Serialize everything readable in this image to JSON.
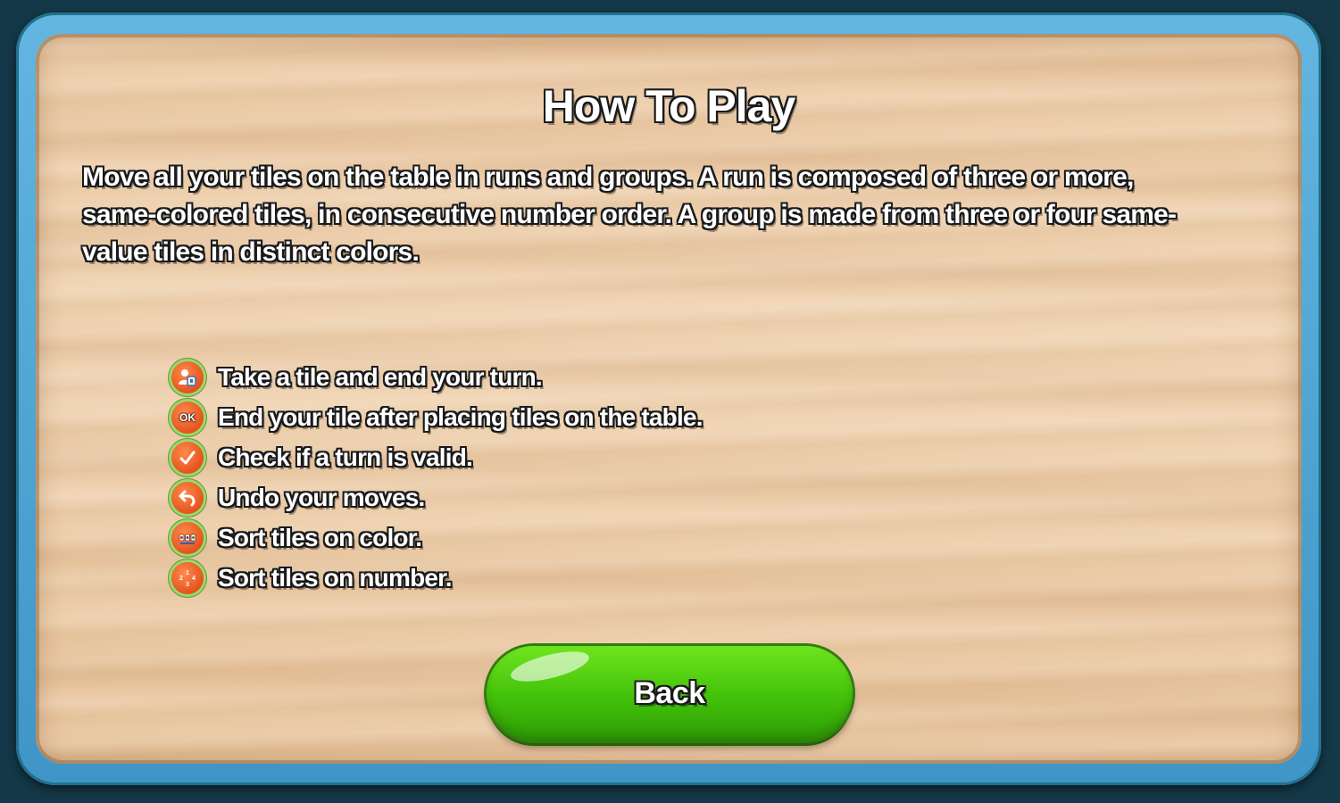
{
  "title": "How To Play",
  "intro": "Move all your tiles on the table in runs and groups. A run is composed of three or more, same-colored tiles, in consecutive number order. A group is made from three or four same-value tiles in distinct colors.",
  "controls": [
    {
      "icon": "take-tile-icon",
      "label": "Take a tile and end your turn."
    },
    {
      "icon": "ok-icon",
      "label": "End your tile after placing tiles on the table.",
      "icon_text": "OK"
    },
    {
      "icon": "checkmark-icon",
      "label": "Check if a turn is valid."
    },
    {
      "icon": "undo-icon",
      "label": "Undo your moves."
    },
    {
      "icon": "sort-color-icon",
      "label": "Sort tiles on color."
    },
    {
      "icon": "sort-number-icon",
      "label": "Sort tiles on number."
    }
  ],
  "back_button": {
    "label": "Back"
  },
  "colors": {
    "frame": "#4aa3d2",
    "wood": "#eccba6",
    "icon_orange": "#e8582a",
    "button_green": "#46c80c"
  }
}
